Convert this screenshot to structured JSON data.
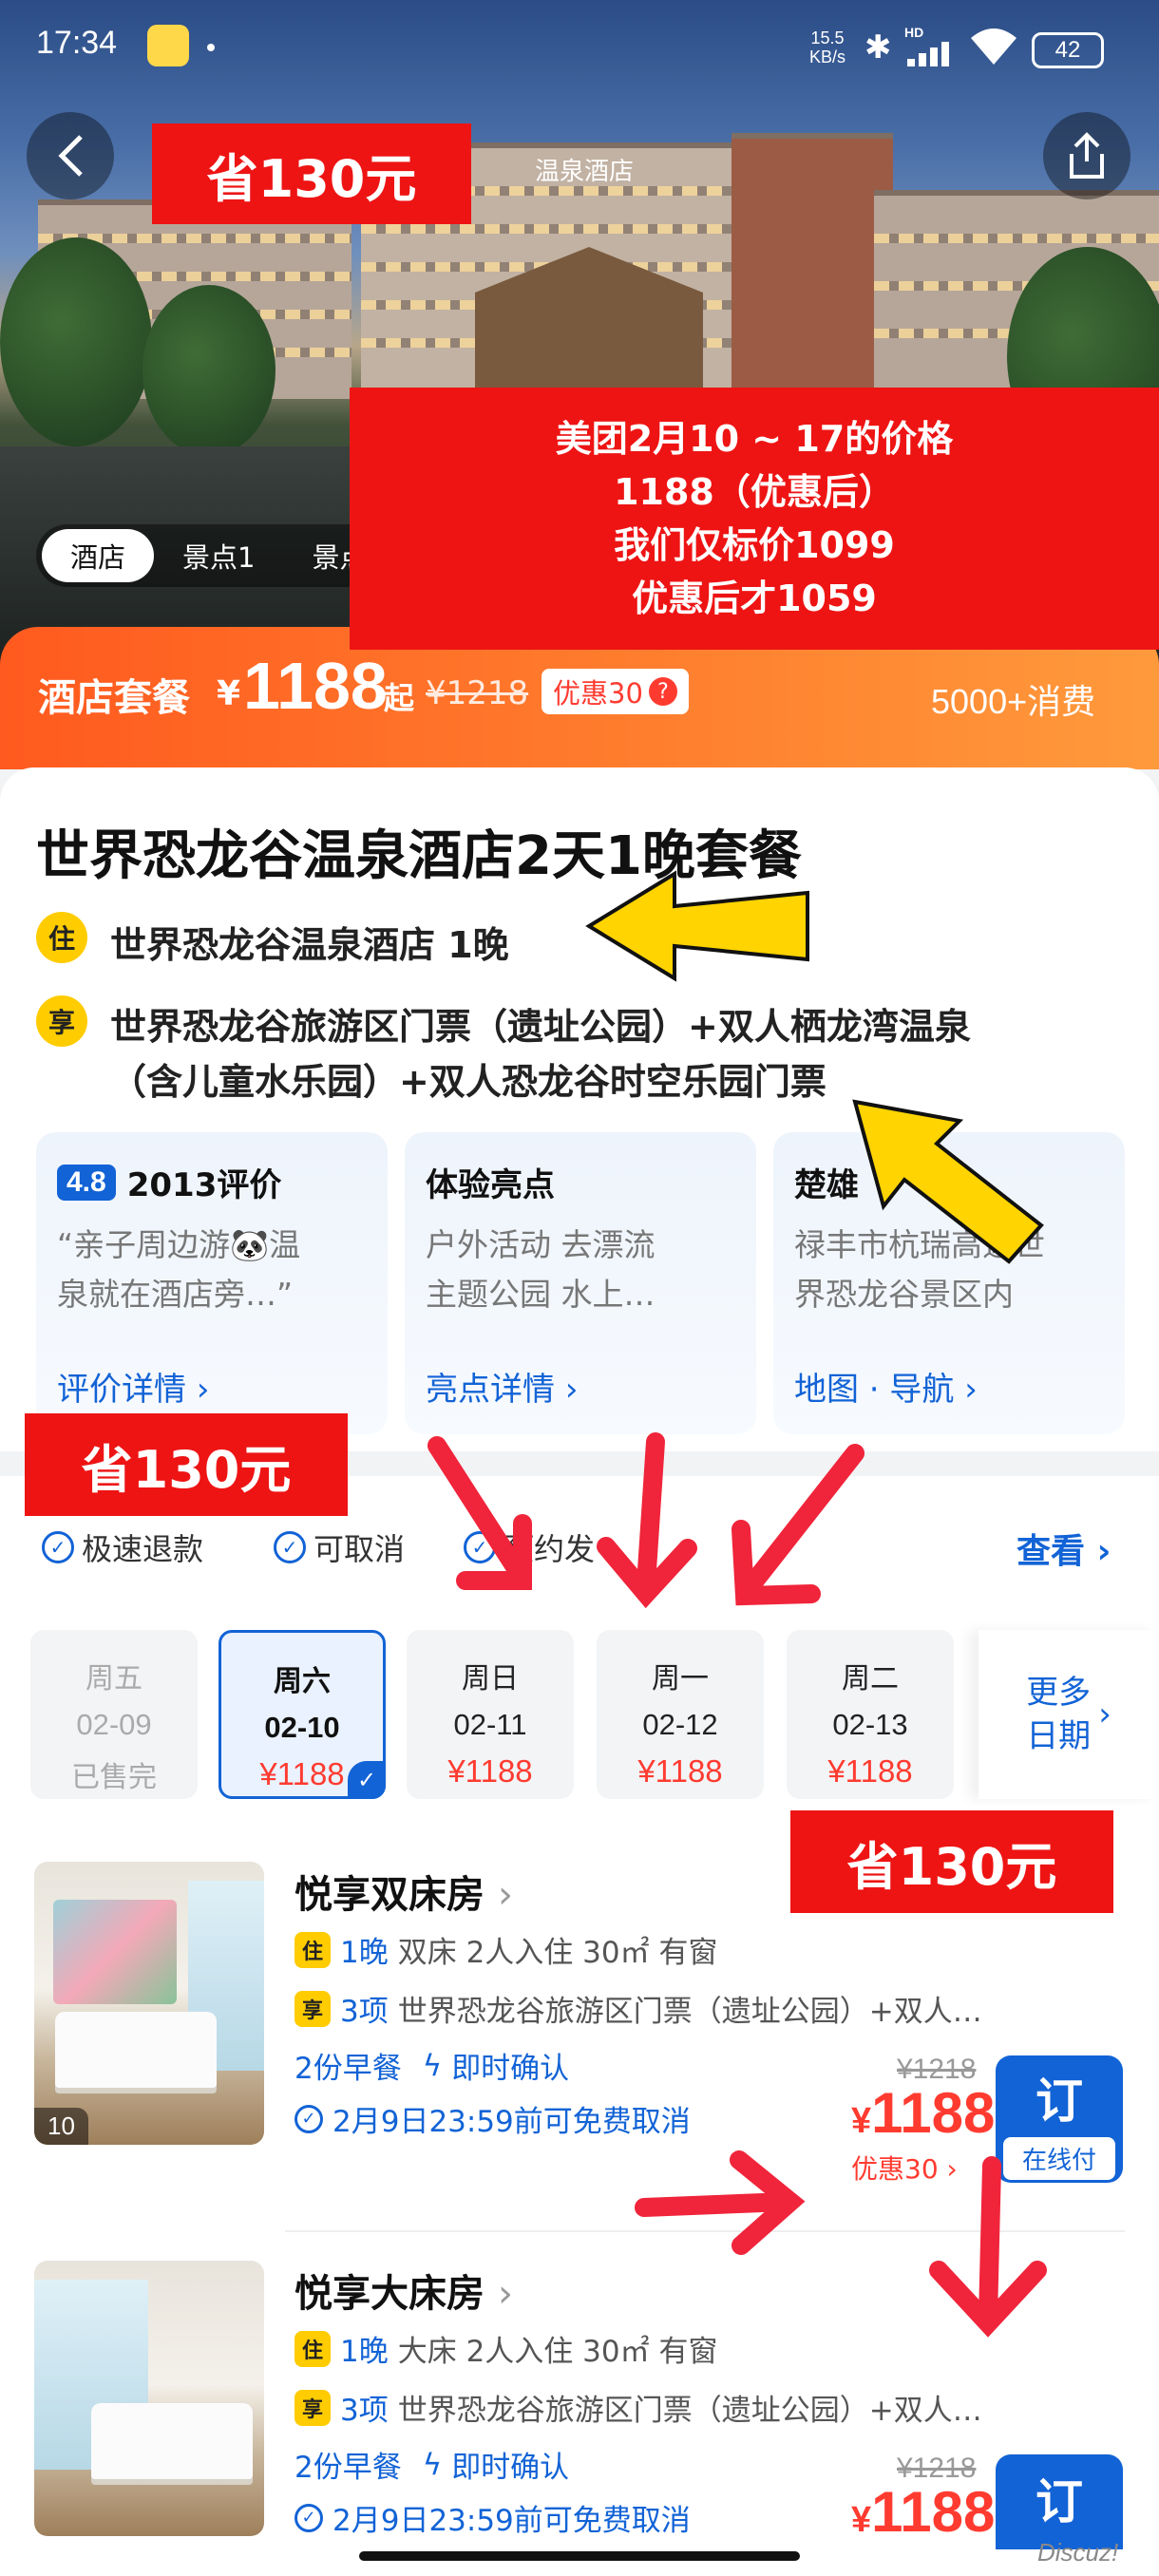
{
  "status_bar": {
    "time": "17:34",
    "net_speed_top": "15.5",
    "net_speed_bottom": "KB/s",
    "hd": "HD",
    "battery": "42"
  },
  "hero": {
    "hotel_sign": "温泉酒店",
    "tabs": [
      "酒店",
      "景点1",
      "景点"
    ]
  },
  "overlays": {
    "save_badge": "省130元",
    "note_lines": [
      "美团2月10 ~ 17的价格",
      "1188（优惠后）",
      "我们仅标价1099",
      "优惠后才1059"
    ]
  },
  "package": {
    "label": "酒店套餐",
    "currency": "¥",
    "price": "1188",
    "suffix": "起",
    "original": "¥1218",
    "discount": "优惠30",
    "help": "?",
    "sales": "5000+消费"
  },
  "product": {
    "title": "世界恐龙谷温泉酒店2天1晚套餐",
    "stay_tag": "住",
    "stay_text": "世界恐龙谷温泉酒店 1晚",
    "enjoy_tag": "享",
    "enjoy_line1": "世界恐龙谷旅游区门票（遗址公园）+双人栖龙湾温泉",
    "enjoy_line2": "（含儿童水乐园）+双人恐龙谷时空乐园门票"
  },
  "info_cards": {
    "rating": "4.8",
    "reviews_title": "2013评价",
    "reviews_line1": "“亲子周边游🐼温",
    "reviews_line2": "泉就在酒店旁…”",
    "reviews_link": "评价详情",
    "highlights_title": "体验亮点",
    "highlights_line1": "户外活动 去漂流",
    "highlights_line2": "主题公园 水上…",
    "highlights_link": "亮点详情",
    "location_title": "楚雄",
    "location_line1": "禄丰市杭瑞高速世",
    "location_line2": "界恐龙谷景区内",
    "location_link": "地图 · 导航"
  },
  "policies": {
    "fast_refund": "极速退款",
    "cancellable": "可取消",
    "booking": "预约发",
    "view": "查看"
  },
  "dates": [
    {
      "weekday": "周五",
      "date": "02-09",
      "price": "已售完"
    },
    {
      "weekday": "周六",
      "date": "02-10",
      "price": "¥1188"
    },
    {
      "weekday": "周日",
      "date": "02-11",
      "price": "¥1188"
    },
    {
      "weekday": "周一",
      "date": "02-12",
      "price": "¥1188"
    },
    {
      "weekday": "周二",
      "date": "02-13",
      "price": "¥1188"
    }
  ],
  "more_dates": {
    "line1": "更多",
    "line2": "日期"
  },
  "rooms": [
    {
      "name": "悦享双床房",
      "stay_tag": "住",
      "nights": "1晚",
      "details": "双床 2人入住 30㎡ 有窗",
      "enjoy_tag": "享",
      "items": "3项",
      "items_detail": "世界恐龙谷旅游区门票（遗址公园）+双人…",
      "breakfast": "2份早餐",
      "confirm": "即时确认",
      "cancel": "2月9日23:59前可免费取消",
      "original": "¥1218",
      "price": "1188",
      "discount": "优惠30",
      "photo_count": "10",
      "book": "订",
      "pay": "在线付"
    },
    {
      "name": "悦享大床房",
      "stay_tag": "住",
      "nights": "1晚",
      "details": "大床 2人入住 30㎡ 有窗",
      "enjoy_tag": "享",
      "items": "3项",
      "items_detail": "世界恐龙谷旅游区门票（遗址公园）+双人…",
      "breakfast": "2份早餐",
      "confirm": "即时确认",
      "cancel": "2月9日23:59前可免费取消",
      "original": "¥1218",
      "price": "1188",
      "book": "订"
    }
  ],
  "watermark": "Discuz!",
  "colors": {
    "accent_blue": "#1263d6",
    "price_red": "#ff3b30",
    "orange": "#ff6a25",
    "annotation_red": "#ee1414",
    "arrow_red": "#f0243a",
    "arrow_yellow": "#ffd400"
  }
}
